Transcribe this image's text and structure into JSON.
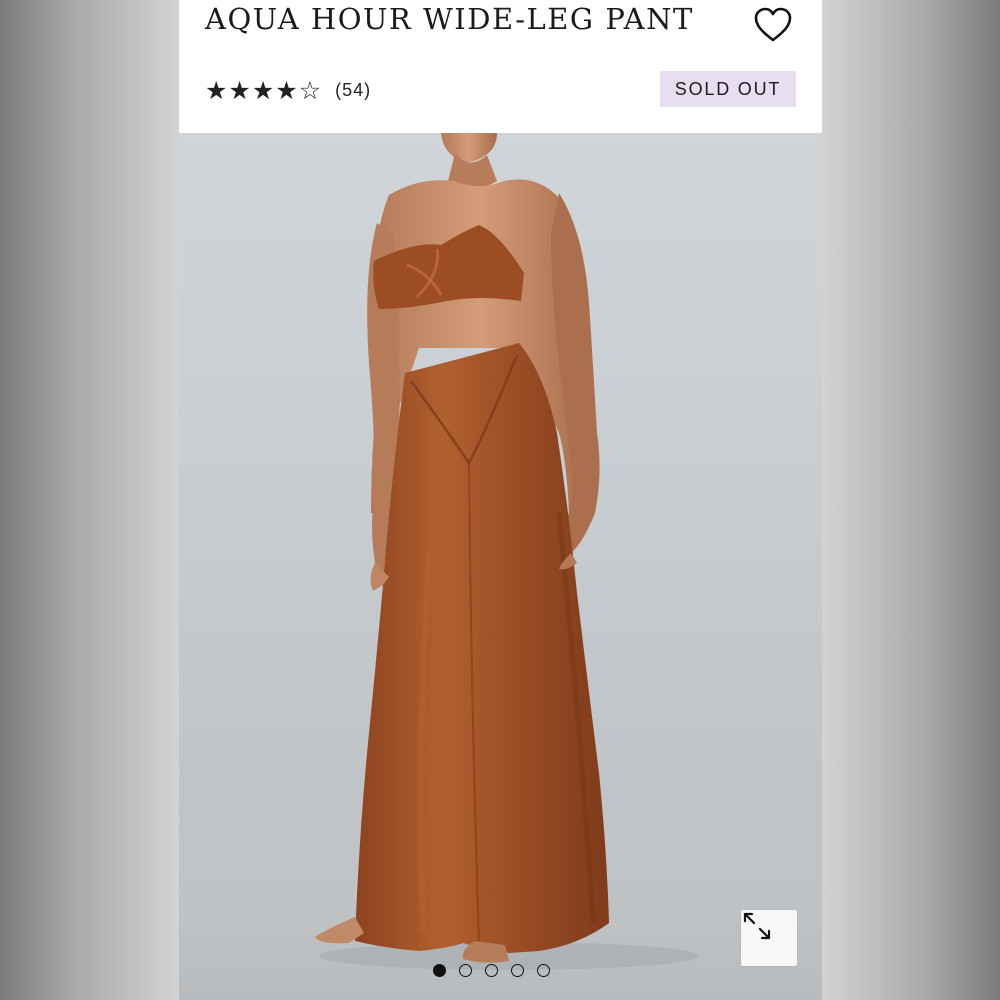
{
  "product": {
    "title": "AQUA HOUR WIDE-LEG PANT",
    "rating_value": 4,
    "rating_max": 5,
    "review_count": "(54)",
    "badge": "SOLD OUT"
  },
  "icons": {
    "favorite": "heart-icon",
    "expand": "expand-arrows-icon",
    "star_filled": "★",
    "star_empty": "☆"
  },
  "gallery": {
    "slide_count": 5,
    "active_index": 0
  },
  "colors": {
    "badge_bg": "#e6dff1",
    "garment": "#a4532a",
    "skin": "#c98e6a"
  }
}
